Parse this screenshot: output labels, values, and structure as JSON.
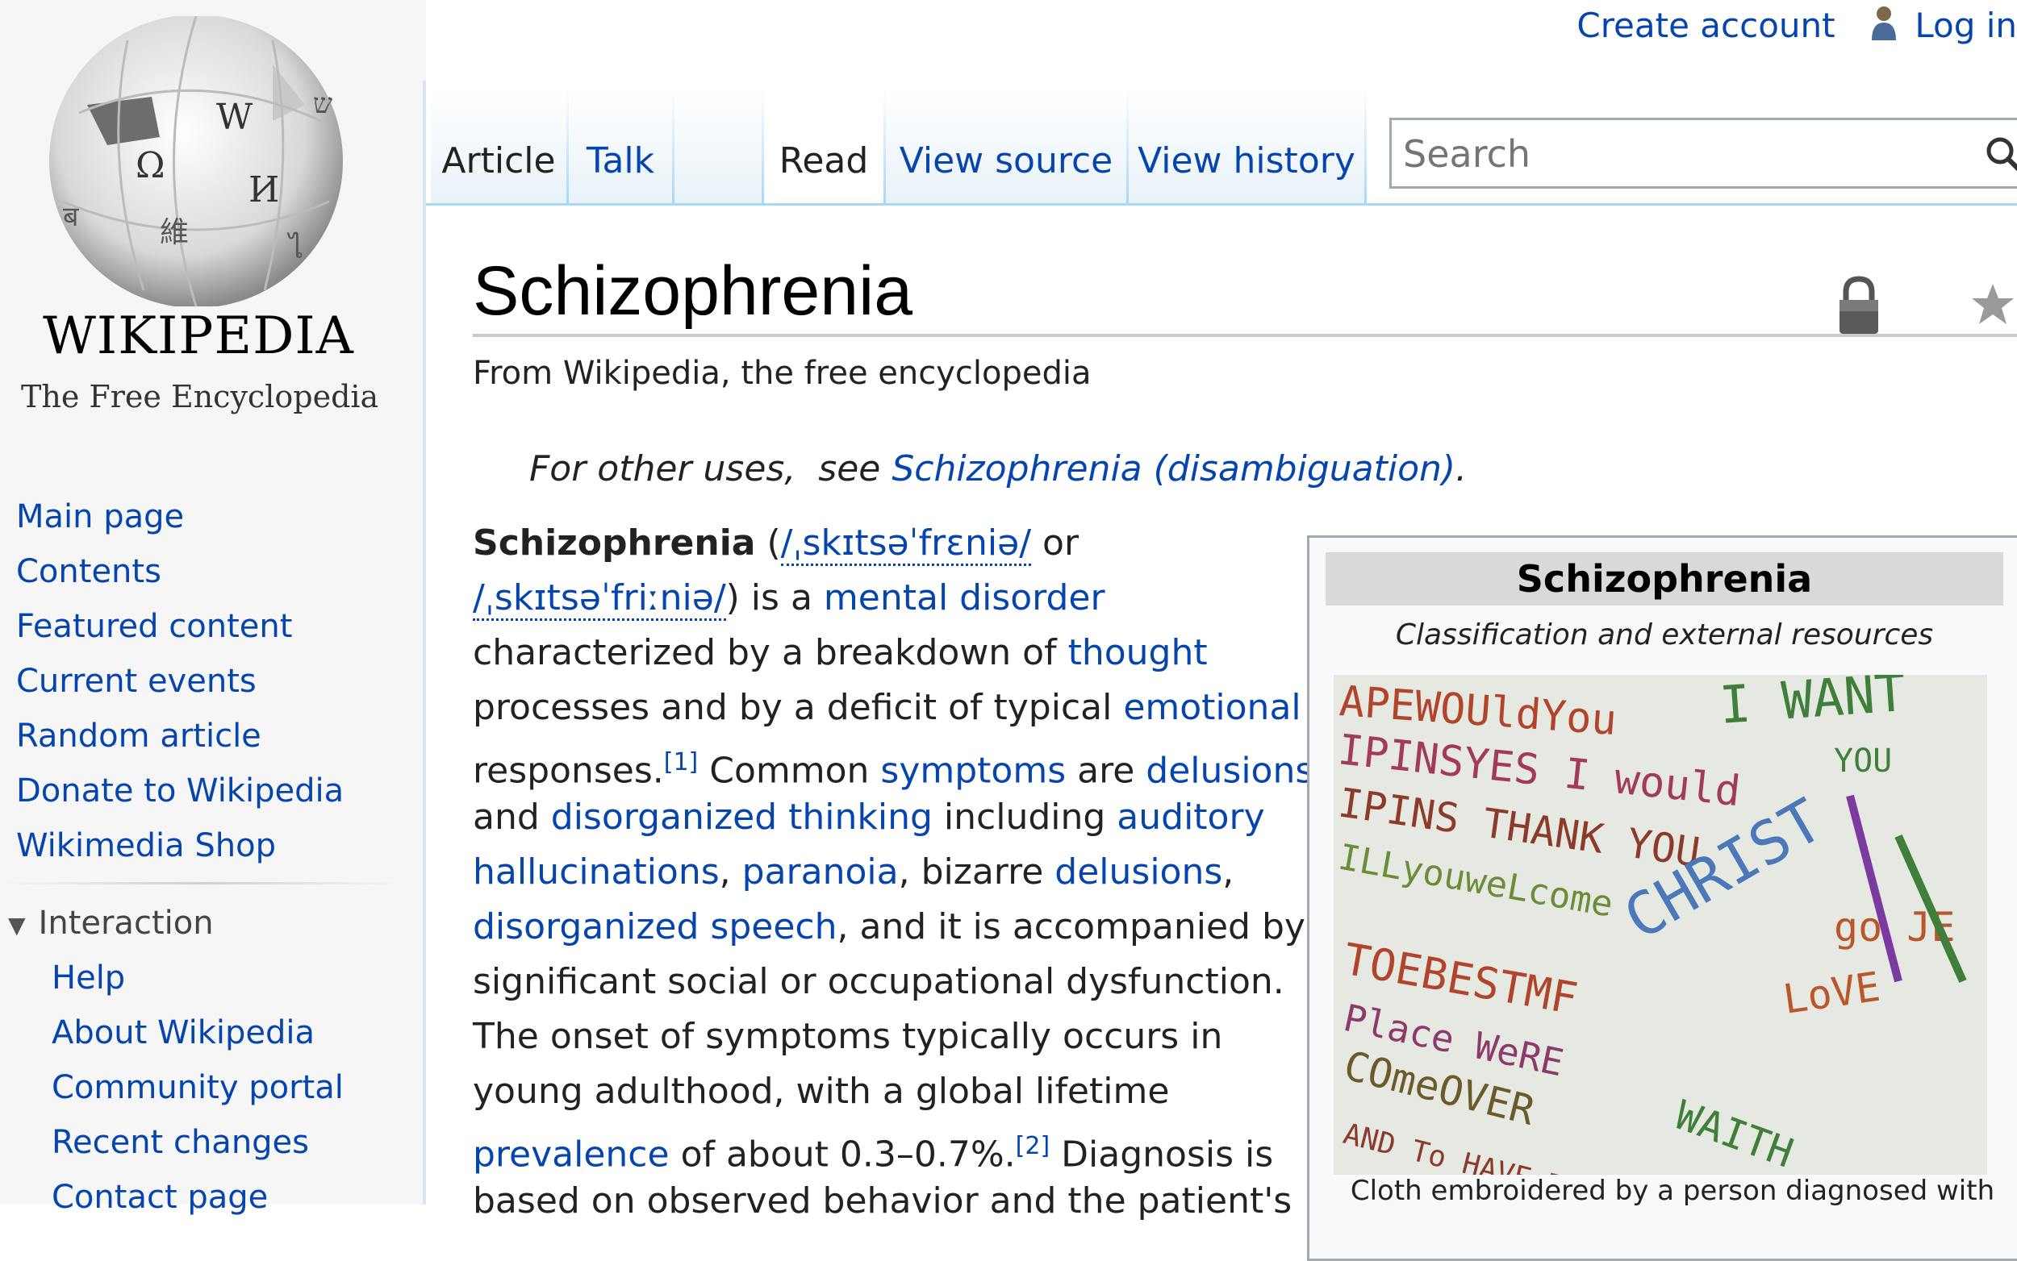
{
  "personal": {
    "create_account": "Create account",
    "log_in": "Log in"
  },
  "logo": {
    "wordmark": "WIKIPEDIA",
    "tagline": "The Free Encyclopedia"
  },
  "sidebar": {
    "nav": [
      "Main page",
      "Contents",
      "Featured content",
      "Current events",
      "Random article",
      "Donate to Wikipedia",
      "Wikimedia Shop"
    ],
    "interaction_heading": "Interaction",
    "interaction": [
      "Help",
      "About Wikipedia",
      "Community portal",
      "Recent changes",
      "Contact page"
    ]
  },
  "tabs": {
    "article": "Article",
    "talk": "Talk",
    "read": "Read",
    "view_source": "View source",
    "view_history": "View history"
  },
  "search": {
    "placeholder": "Search"
  },
  "article": {
    "title": "Schizophrenia",
    "tagline": "From Wikipedia, the free encyclopedia",
    "hatnote_prefix": "For other uses,  see ",
    "hatnote_link": "Schizophrenia (disambiguation)",
    "hatnote_suffix": ".",
    "lead": {
      "term": "Schizophrenia",
      "ipa1": "/ˌskɪtsəˈfrɛniə/",
      "or": " or",
      "ipa2": "/ˌskɪtsəˈfriːniə/",
      "is_a": ") is a ",
      "mental_disorder": "mental disorder",
      "l3a": "characterized by a breakdown of ",
      "thought": "thought",
      "l4a": "processes and by a deficit of typical ",
      "emotional": "emotional",
      "l5a": "responses.",
      "ref1": "[1]",
      "l5b": " Common ",
      "symptoms": "symptoms",
      "l5c": " are ",
      "delusions": "delusions",
      "l6a": "and ",
      "disorganized_thinking": "disorganized thinking",
      "l6b": " including ",
      "auditory": "auditory",
      "hallucinations": "hallucinations",
      "comma": ", ",
      "paranoia": "paranoia",
      "bizarre": ", bizarre ",
      "delusions2": "delusions",
      "comma2": ",",
      "disorganized_speech": "disorganized speech",
      "l8b": ", and it is accompanied by",
      "l9": "significant social or occupational dysfunction.",
      "l10": "The onset of symptoms typically occurs in",
      "l11": "young adulthood, with a global lifetime",
      "prevalence": "prevalence",
      "l12b": " of about 0.3–0.7%.",
      "ref2": "[2]",
      "l12c": " Diagnosis is",
      "l13": "based on observed behavior and the patient's"
    }
  },
  "infobox": {
    "title": "Schizophrenia",
    "subtitle": "Classification and external resources",
    "image_words": [
      "APEWOUldYou",
      "IPINSYES I would",
      "IPINS THANK YOU",
      "ILLyouweLcome",
      "I WANT",
      "YOU",
      "CHRIST",
      "go JE",
      "LoVE",
      "TOEBESTMF",
      "Place WeRE",
      "COmeOVER",
      "WAITH",
      "AND To HAVE To"
    ],
    "caption": "Cloth embroidered by a person diagnosed with"
  }
}
